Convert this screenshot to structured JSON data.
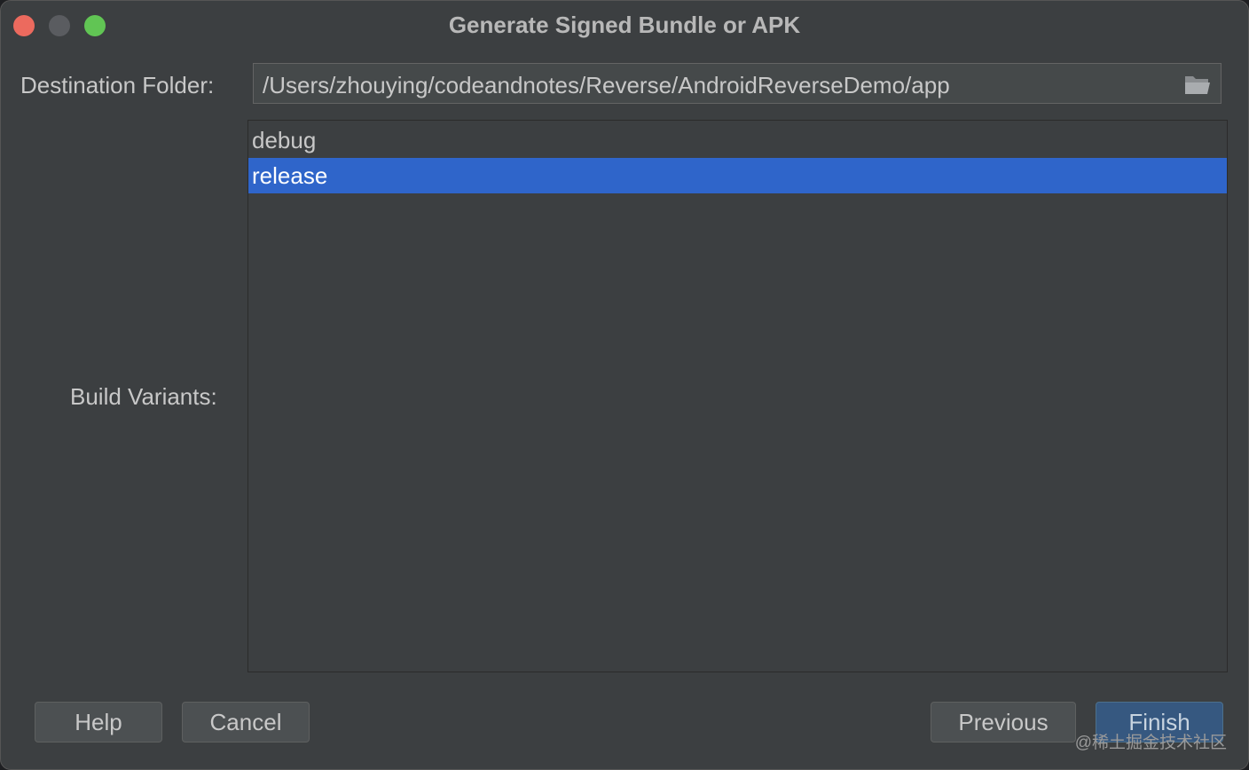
{
  "window": {
    "title": "Generate Signed Bundle or APK",
    "controls": [
      "close",
      "minimize",
      "zoom"
    ]
  },
  "destination": {
    "label": "Destination Folder:",
    "path": "/Users/zhouying/codeandnotes/Reverse/AndroidReverseDemo/app",
    "browse_icon": "folder-icon"
  },
  "build_variants": {
    "label": "Build Variants:",
    "items": [
      {
        "label": "debug",
        "selected": false
      },
      {
        "label": "release",
        "selected": true
      }
    ]
  },
  "buttons": {
    "help": "Help",
    "cancel": "Cancel",
    "previous": "Previous",
    "finish": "Finish"
  },
  "watermark": "@稀土掘金技术社区",
  "colors": {
    "background": "#3c3f41",
    "selection": "#2f65ca",
    "primary_button": "#365880"
  }
}
